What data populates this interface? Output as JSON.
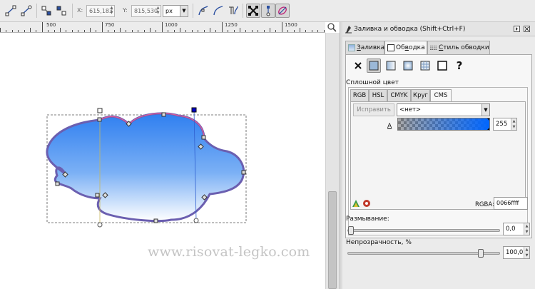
{
  "toolbar": {
    "x_label": "X:",
    "x_value": "615,183",
    "y_label": "Y:",
    "y_value": "815,530",
    "unit": "px"
  },
  "ruler": {
    "labels": [
      "500",
      "750",
      "1000",
      "1250",
      "1500"
    ]
  },
  "canvas": {
    "watermark": "www.risovat-legko.com",
    "shape_gradient": {
      "top": "#2f7ff0",
      "bottom": "#ffffff"
    },
    "shape_stroke": "#6b5fb0"
  },
  "fill_stroke_panel": {
    "title": "Заливка и обводка (Shift+Ctrl+F)",
    "tabs": [
      {
        "label_pre": "",
        "label_ul": "З",
        "label_post": "аливка"
      },
      {
        "label_pre": "Об",
        "label_ul": "в",
        "label_post": "одка"
      },
      {
        "label_pre": "",
        "label_ul": "С",
        "label_post": "тиль обводки"
      }
    ],
    "paint_types": [
      "no-paint",
      "flat-color",
      "linear-gradient",
      "radial-gradient",
      "pattern",
      "swatch",
      "unset"
    ],
    "unset_glyph": "?",
    "flat_color_title": "Сплошной цвет",
    "color_tabs": [
      "RGB",
      "HSL",
      "CMYK",
      "Круг",
      "CMS"
    ],
    "cms": {
      "fix_button": "Исправить",
      "profile": "<нет>",
      "alpha_label": "A",
      "alpha_value": "255"
    },
    "rgba_label": "RGBA:",
    "rgba_value": "0066ffff",
    "blur_label": "Размывание:",
    "blur_value": "0,0",
    "blur_level": 0.0,
    "opacity_label": "Непрозрачность, %",
    "opacity_value": "100,0",
    "opacity_level": 100.0
  }
}
